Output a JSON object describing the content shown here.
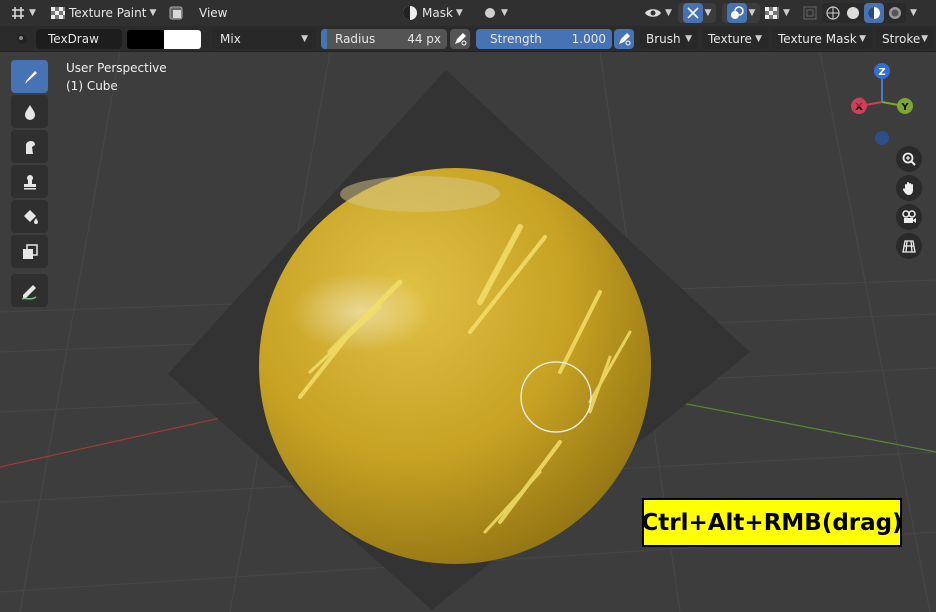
{
  "header": {
    "mode_label": "Texture Paint",
    "view_menu": "View",
    "mask_label": "Mask"
  },
  "tool_settings": {
    "brush_name": "TexDraw",
    "blend_mode": "Mix",
    "radius_label": "Radius",
    "radius_value": "44 px",
    "strength_label": "Strength",
    "strength_value": "1.000",
    "brush_menu": "Brush",
    "texture_menu": "Texture",
    "texture_mask_menu": "Texture Mask",
    "stroke_menu": "Stroke",
    "primary_color": "#000000",
    "secondary_color": "#ffffff"
  },
  "viewport": {
    "perspective_label": "User Perspective",
    "object_label": "(1) Cube",
    "gizmo": {
      "z": "Z",
      "y": "Y",
      "x": "X"
    }
  },
  "toolbar_tools": [
    "draw-tool",
    "soften-tool",
    "smear-tool",
    "clone-tool",
    "fill-tool",
    "mask-tool",
    "annotate-tool"
  ],
  "hint": {
    "text": "Ctrl+Alt+RMB(drag)"
  },
  "colors": {
    "accent": "#4772b3",
    "sphere": "#c9a423",
    "hint_bg": "#ffff00"
  }
}
